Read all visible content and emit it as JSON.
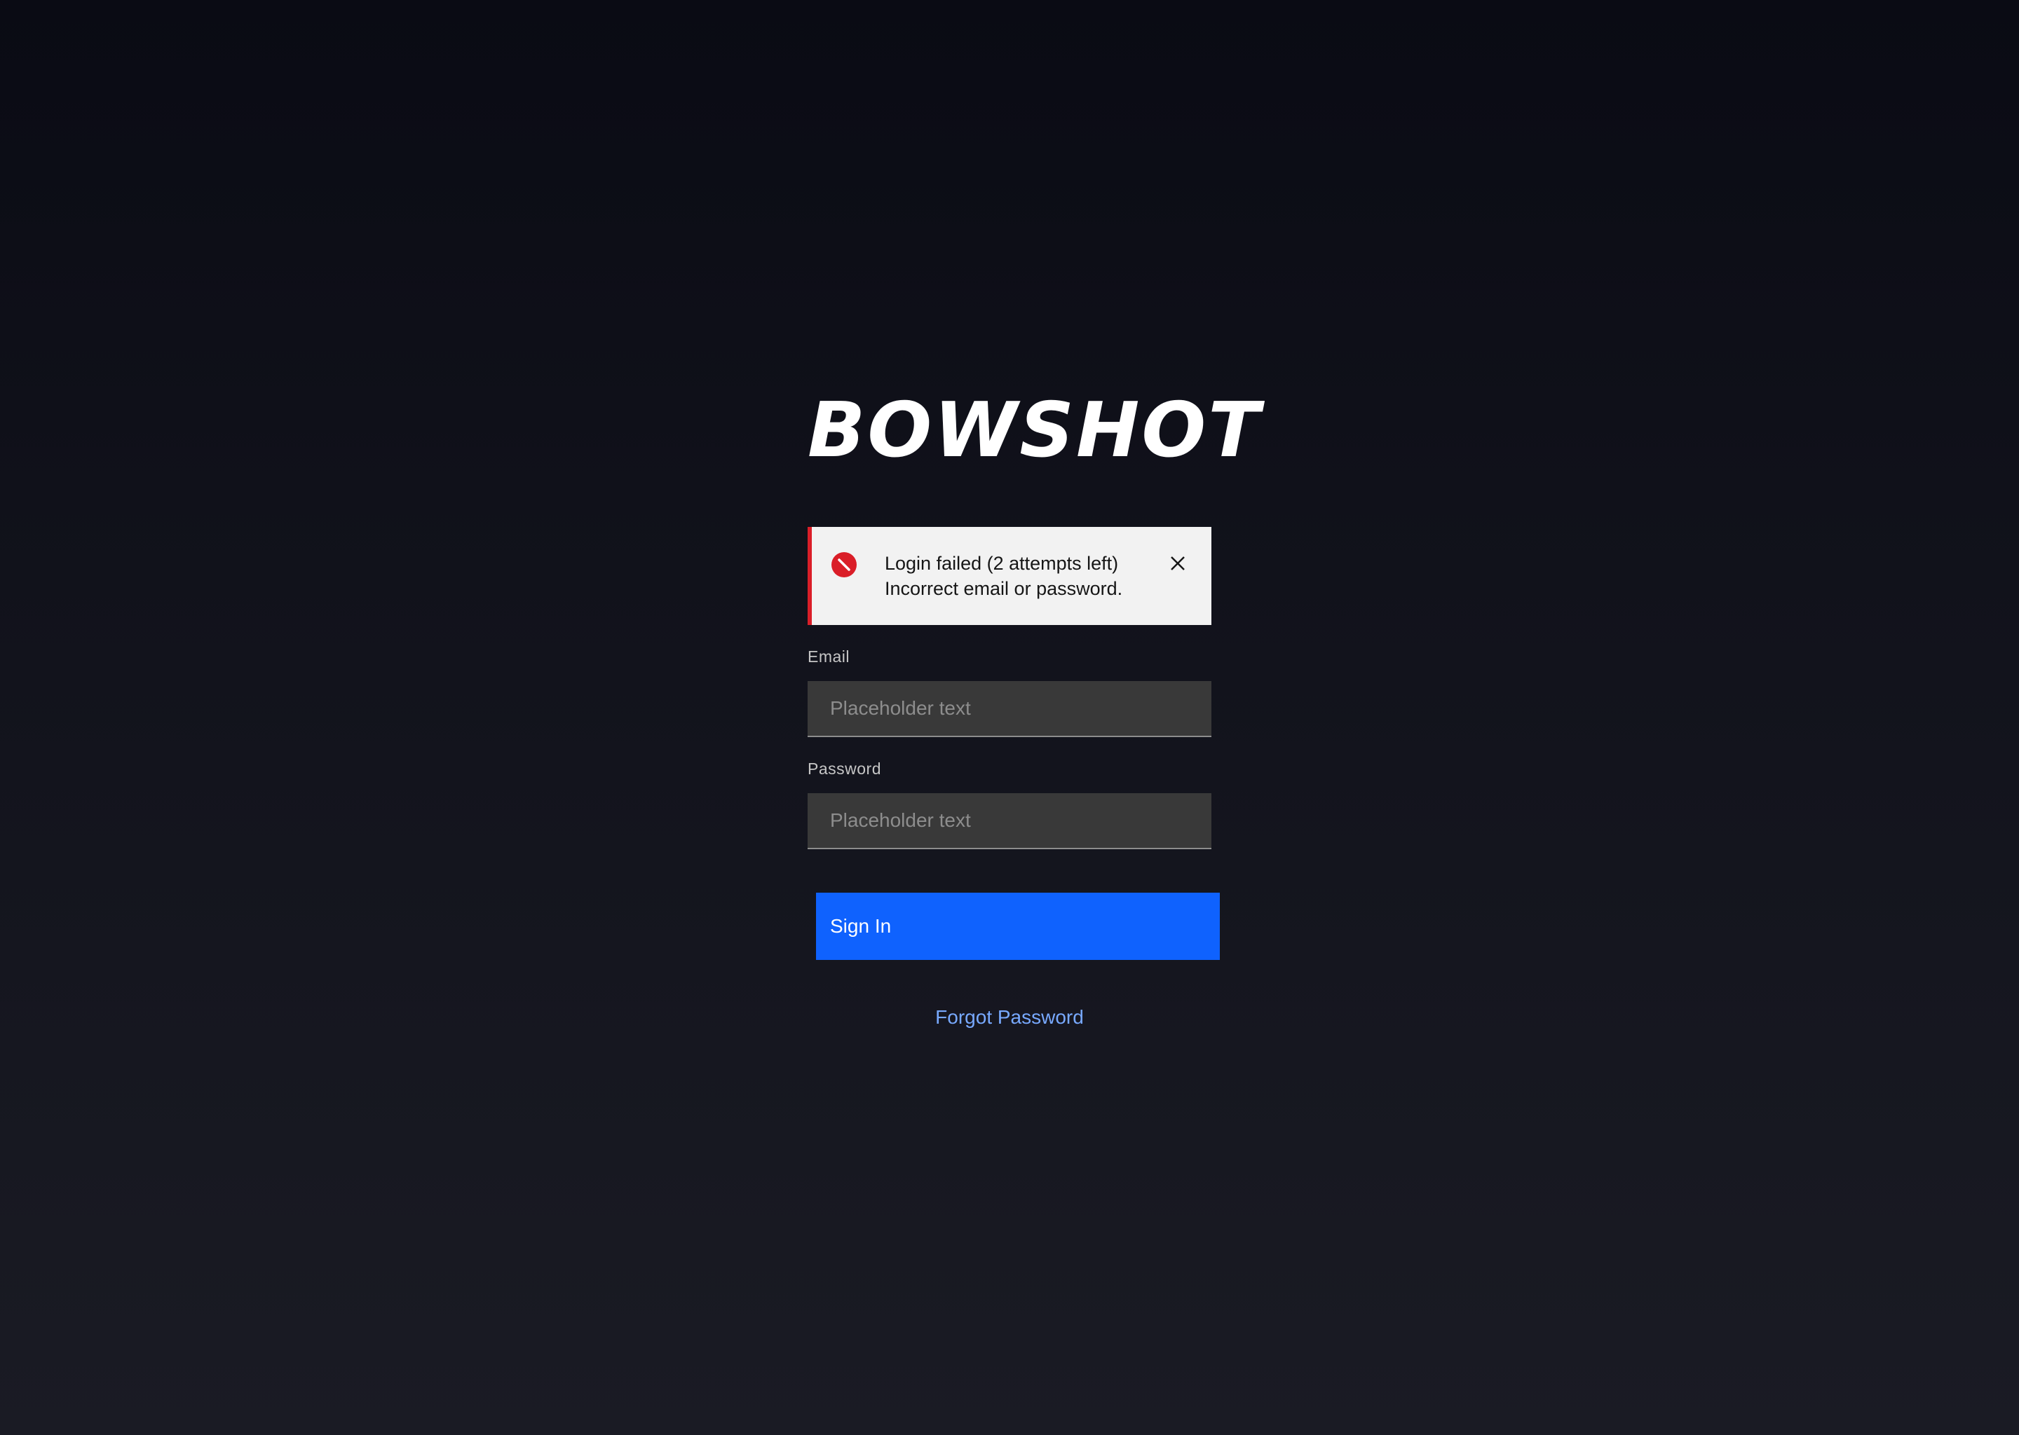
{
  "brand": {
    "name": "BOWSHOT"
  },
  "alert": {
    "title": "Login failed (2 attempts left)",
    "message": "Incorrect email or password.",
    "icon": "error-icon",
    "close_icon": "close-icon",
    "accent_color": "#da1e28"
  },
  "form": {
    "email": {
      "label": "Email",
      "value": "",
      "placeholder": "Placeholder text"
    },
    "password": {
      "label": "Password",
      "value": "",
      "placeholder": "Placeholder text"
    },
    "submit_label": "Sign In",
    "forgot_label": "Forgot Password"
  },
  "colors": {
    "primary": "#0f62fe",
    "link": "#78a9ff",
    "input_bg": "#393939"
  }
}
